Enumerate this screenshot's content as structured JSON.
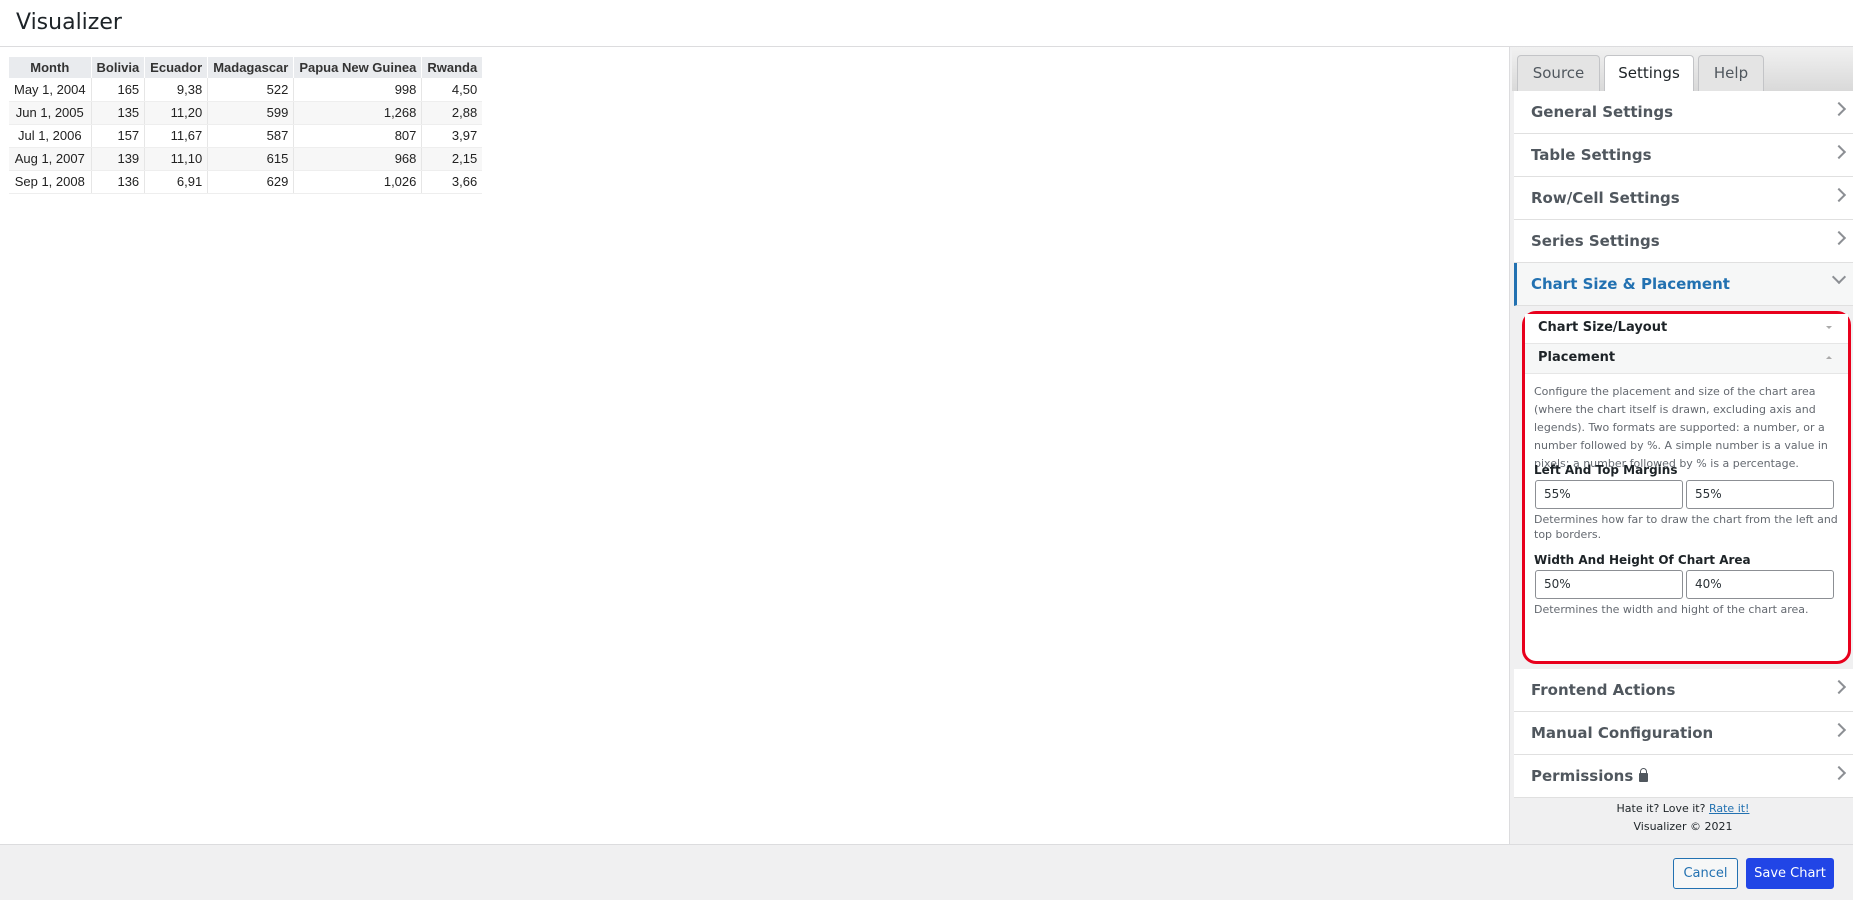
{
  "app": {
    "title": "Visualizer"
  },
  "table": {
    "columns": [
      "Month",
      "Bolivia",
      "Ecuador",
      "Madagascar",
      "Papua New Guinea",
      "Rwanda"
    ],
    "rows": [
      [
        "May 1, 2004",
        "165",
        "9,38",
        "522",
        "998",
        "4,50"
      ],
      [
        "Jun 1, 2005",
        "135",
        "11,20",
        "599",
        "1,268",
        "2,88"
      ],
      [
        "Jul 1, 2006",
        "157",
        "11,67",
        "587",
        "807",
        "3,97"
      ],
      [
        "Aug 1, 2007",
        "139",
        "11,10",
        "615",
        "968",
        "2,15"
      ],
      [
        "Sep 1, 2008",
        "136",
        "6,91",
        "629",
        "1,026",
        "3,66"
      ]
    ]
  },
  "sidebar": {
    "tabs": [
      "Source",
      "Settings",
      "Help"
    ],
    "active_tab": "Settings",
    "groups": [
      "General Settings",
      "Table Settings",
      "Row/Cell Settings",
      "Series Settings"
    ],
    "open_group": "Chart Size & Placement",
    "subsections": {
      "layout_title": "Chart Size/Layout",
      "placement_title": "Placement",
      "description": "Configure the placement and size of the chart area (where the chart itself is drawn, excluding axis and legends). Two formats are supported: a number, or a number followed by %. A simple number is a value in pixels; a number followed by % is a percentage.",
      "margins_label": "Left And Top Margins",
      "left_margin": "55%",
      "top_margin": "55%",
      "margins_hint": "Determines how far to draw the chart from the left and top borders.",
      "area_label": "Width And Height Of Chart Area",
      "area_width": "50%",
      "area_height": "40%",
      "area_hint": "Determines the width and hight of the chart area."
    },
    "lower_groups": [
      "Frontend Actions",
      "Manual Configuration",
      "Permissions"
    ],
    "footer": {
      "prompt": "Hate it? Love it?",
      "rate_link": "Rate it!",
      "copyright": "Visualizer © 2021"
    }
  },
  "actions": {
    "cancel": "Cancel",
    "save": "Save Chart"
  },
  "colors": {
    "accent": "#2271b1",
    "save_button": "#2145e6",
    "highlight_border": "#e8001c"
  }
}
